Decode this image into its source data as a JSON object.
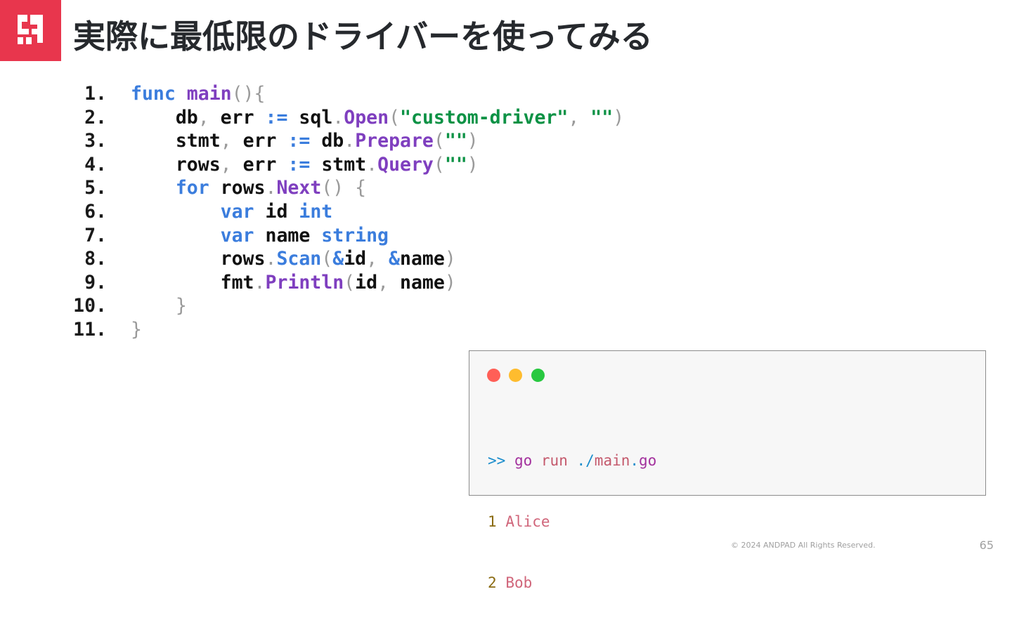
{
  "slide": {
    "title": "実際に最低限のドライバーを使ってみる",
    "logo": "andpad-logo",
    "footer": "© 2024 ANDPAD All Rights Reserved.",
    "page_number": "65"
  },
  "code": {
    "lines": [
      {
        "n": "1.",
        "tokens": [
          [
            "kw",
            "func"
          ],
          [
            "sp",
            " "
          ],
          [
            "fn",
            "main"
          ],
          [
            "pn",
            "(){"
          ]
        ]
      },
      {
        "n": "2.",
        "tokens": [
          [
            "sp",
            "    "
          ],
          [
            "id",
            "db"
          ],
          [
            "pn",
            ", "
          ],
          [
            "id",
            "err"
          ],
          [
            "sp",
            " "
          ],
          [
            "kw",
            ":="
          ],
          [
            "sp",
            " "
          ],
          [
            "id",
            "sql"
          ],
          [
            "pn",
            "."
          ],
          [
            "fn",
            "Open"
          ],
          [
            "pn",
            "("
          ],
          [
            "str",
            "\"custom-driver\""
          ],
          [
            "pn",
            ", "
          ],
          [
            "str",
            "\"\""
          ],
          [
            "pn",
            ")"
          ]
        ]
      },
      {
        "n": "3.",
        "tokens": [
          [
            "sp",
            "    "
          ],
          [
            "id",
            "stmt"
          ],
          [
            "pn",
            ", "
          ],
          [
            "id",
            "err"
          ],
          [
            "sp",
            " "
          ],
          [
            "kw",
            ":="
          ],
          [
            "sp",
            " "
          ],
          [
            "id",
            "db"
          ],
          [
            "pn",
            "."
          ],
          [
            "fn",
            "Prepare"
          ],
          [
            "pn",
            "("
          ],
          [
            "str",
            "\"\""
          ],
          [
            "pn",
            ")"
          ]
        ]
      },
      {
        "n": "4.",
        "tokens": [
          [
            "sp",
            "    "
          ],
          [
            "id",
            "rows"
          ],
          [
            "pn",
            ", "
          ],
          [
            "id",
            "err"
          ],
          [
            "sp",
            " "
          ],
          [
            "kw",
            ":="
          ],
          [
            "sp",
            " "
          ],
          [
            "id",
            "stmt"
          ],
          [
            "pn",
            "."
          ],
          [
            "fn",
            "Query"
          ],
          [
            "pn",
            "("
          ],
          [
            "str",
            "\"\""
          ],
          [
            "pn",
            ")"
          ]
        ]
      },
      {
        "n": "5.",
        "tokens": [
          [
            "sp",
            "    "
          ],
          [
            "kw",
            "for"
          ],
          [
            "sp",
            " "
          ],
          [
            "id",
            "rows"
          ],
          [
            "pn",
            "."
          ],
          [
            "fn",
            "Next"
          ],
          [
            "pn",
            "() {"
          ]
        ]
      },
      {
        "n": "6.",
        "tokens": [
          [
            "sp",
            "        "
          ],
          [
            "kw",
            "var"
          ],
          [
            "sp",
            " "
          ],
          [
            "id",
            "id"
          ],
          [
            "sp",
            " "
          ],
          [
            "kw",
            "int"
          ]
        ]
      },
      {
        "n": "7.",
        "tokens": [
          [
            "sp",
            "        "
          ],
          [
            "kw",
            "var"
          ],
          [
            "sp",
            " "
          ],
          [
            "id",
            "name"
          ],
          [
            "sp",
            " "
          ],
          [
            "kw",
            "string"
          ]
        ]
      },
      {
        "n": "8.",
        "tokens": [
          [
            "sp",
            "        "
          ],
          [
            "id",
            "rows"
          ],
          [
            "pn",
            "."
          ],
          [
            "kw",
            "Scan"
          ],
          [
            "pn",
            "("
          ],
          [
            "kw",
            "&"
          ],
          [
            "id",
            "id"
          ],
          [
            "pn",
            ", "
          ],
          [
            "kw",
            "&"
          ],
          [
            "id",
            "name"
          ],
          [
            "pn",
            ")"
          ]
        ]
      },
      {
        "n": "9.",
        "tokens": [
          [
            "sp",
            "        "
          ],
          [
            "id",
            "fmt"
          ],
          [
            "pn",
            "."
          ],
          [
            "fn",
            "Println"
          ],
          [
            "pn",
            "("
          ],
          [
            "id",
            "id"
          ],
          [
            "pn",
            ", "
          ],
          [
            "id",
            "name"
          ],
          [
            "pn",
            ")"
          ]
        ]
      },
      {
        "n": "10.",
        "tokens": [
          [
            "sp",
            "    "
          ],
          [
            "pn",
            "}"
          ]
        ]
      },
      {
        "n": "11.",
        "tokens": [
          [
            "pn",
            "}"
          ]
        ]
      }
    ]
  },
  "terminal": {
    "prompt": ">>",
    "command": "go",
    "subcommand": "run",
    "path_prefix": "./",
    "file_base": "main",
    "file_dot": ".",
    "file_ext": "go",
    "output": [
      {
        "id": "1",
        "name": "Alice"
      },
      {
        "id": "2",
        "name": "Bob"
      }
    ],
    "dot_colors": [
      "#ff5f57",
      "#febc2e",
      "#28c840"
    ]
  },
  "colors": {
    "accent": "#e8364d",
    "keyword": "#3b7ddd",
    "function": "#7f3fbf",
    "string": "#0c9245"
  }
}
